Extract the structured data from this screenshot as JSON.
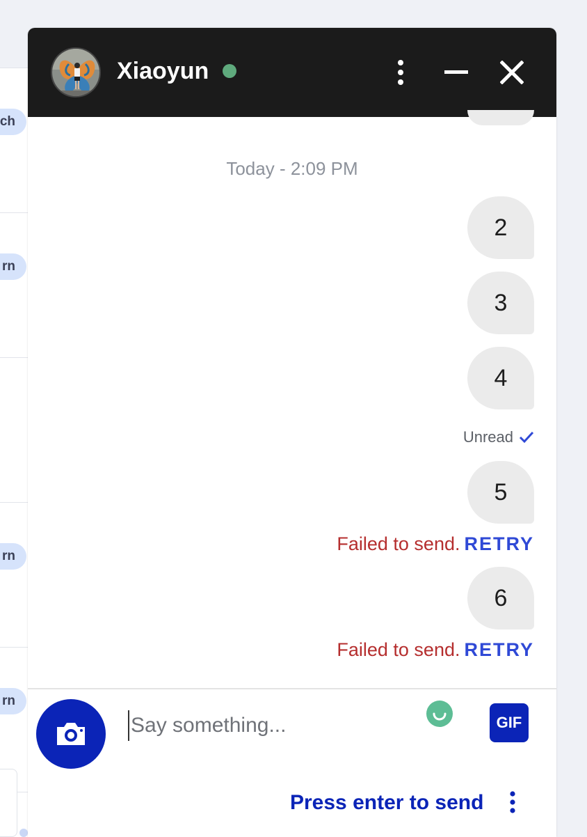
{
  "background": {
    "pill_labels": [
      "ch",
      "rn",
      "rn",
      "rn"
    ]
  },
  "chat": {
    "header": {
      "name": "Xiaoyun",
      "status": "online",
      "icons": [
        "more-vertical-icon",
        "minimize-icon",
        "close-icon"
      ]
    },
    "thread": {
      "day_stamp": "Today - 2:09 PM",
      "messages": [
        {
          "text": "2"
        },
        {
          "text": "3"
        },
        {
          "text": "4"
        },
        {
          "text": "5"
        },
        {
          "text": "6"
        }
      ],
      "read_receipt": "Unread",
      "failed_text": "Failed to send.",
      "retry_label": "RETRY"
    },
    "composer": {
      "placeholder": "Say something...",
      "gif_label": "GIF",
      "enter_hint": "Press enter to send"
    }
  },
  "colors": {
    "header_bg": "#1b1b1b",
    "accent": "#0b24b7",
    "online": "#5faa7d",
    "error": "#b52e2e",
    "retry": "#2f49d6",
    "bubble": "#ebebeb"
  }
}
